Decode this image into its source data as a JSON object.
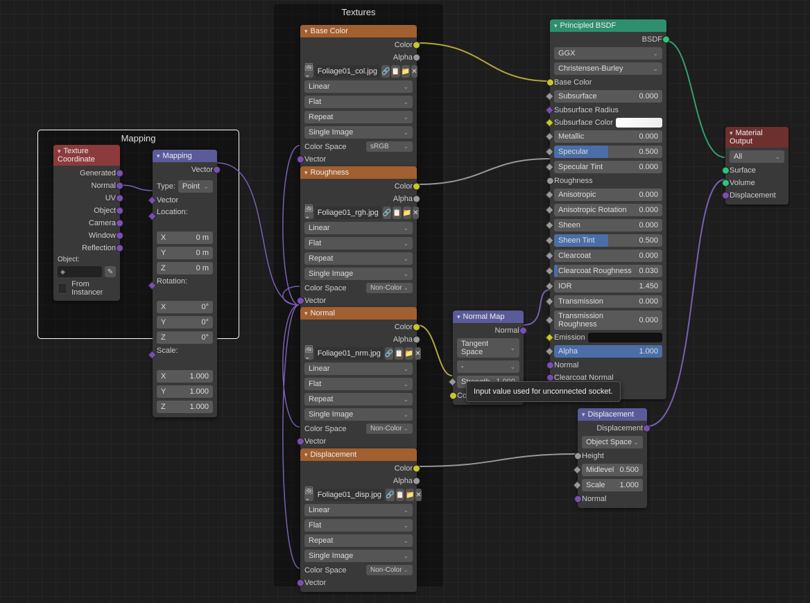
{
  "frames": {
    "mapping": {
      "title": "Mapping"
    },
    "textures": {
      "title": "Textures"
    }
  },
  "texcoord": {
    "title": "Texture Coordinate",
    "outputs": [
      "Generated",
      "Normal",
      "UV",
      "Object",
      "Camera",
      "Window",
      "Reflection"
    ],
    "object_label": "Object:",
    "from_instancer": "From Instancer"
  },
  "mapping": {
    "title": "Mapping",
    "out_vector": "Vector",
    "type_label": "Type:",
    "type_value": "Point",
    "in_vector": "Vector",
    "loc_label": "Location:",
    "rot_label": "Rotation:",
    "scale_label": "Scale:",
    "xyz_loc": [
      [
        "X",
        "0 m"
      ],
      [
        "Y",
        "0 m"
      ],
      [
        "Z",
        "0 m"
      ]
    ],
    "xyz_rot": [
      [
        "X",
        "0°"
      ],
      [
        "Y",
        "0°"
      ],
      [
        "Z",
        "0°"
      ]
    ],
    "xyz_scale": [
      [
        "X",
        "1.000"
      ],
      [
        "Y",
        "1.000"
      ],
      [
        "Z",
        "1.000"
      ]
    ]
  },
  "image_nodes": {
    "base_color": {
      "title": "Base Color",
      "file": "Foliage01_col.jpg",
      "cs": "sRGB"
    },
    "roughness": {
      "title": "Roughness",
      "file": "Foliage01_rgh.jpg",
      "cs": "Non-Color"
    },
    "normal": {
      "title": "Normal",
      "file": "Foliage01_nrm.jpg",
      "cs": "Non-Color"
    },
    "displacement": {
      "title": "Displacement",
      "file": "Foliage01_disp.jpg",
      "cs": "Non-Color"
    },
    "common": {
      "out_color": "Color",
      "out_alpha": "Alpha",
      "interp": "Linear",
      "proj": "Flat",
      "ext": "Repeat",
      "src": "Single Image",
      "cs_label": "Color Space",
      "in_vector": "Vector"
    }
  },
  "normal_map": {
    "title": "Normal Map",
    "out_normal": "Normal",
    "space": "Tangent Space",
    "strength_label": "Strength",
    "strength_value": "1.000",
    "in_color": "Color"
  },
  "bsdf": {
    "title": "Principled BSDF",
    "out": "BSDF",
    "dist": "GGX",
    "sss": "Christensen-Burley",
    "inputs": [
      {
        "name": "Base Color",
        "type": "color"
      },
      {
        "name": "Subsurface",
        "type": "slider",
        "val": "0.000",
        "fill": 0
      },
      {
        "name": "Subsurface Radius",
        "type": "vector"
      },
      {
        "name": "Subsurface Color",
        "type": "swatch"
      },
      {
        "name": "Metallic",
        "type": "slider",
        "val": "0.000",
        "fill": 0
      },
      {
        "name": "Specular",
        "type": "slider",
        "val": "0.500",
        "fill": 50
      },
      {
        "name": "Specular Tint",
        "type": "slider",
        "val": "0.000",
        "fill": 0
      },
      {
        "name": "Roughness",
        "type": "linked"
      },
      {
        "name": "Anisotropic",
        "type": "slider",
        "val": "0.000",
        "fill": 0
      },
      {
        "name": "Anisotropic Rotation",
        "type": "slider",
        "val": "0.000",
        "fill": 0
      },
      {
        "name": "Sheen",
        "type": "slider",
        "val": "0.000",
        "fill": 0
      },
      {
        "name": "Sheen Tint",
        "type": "slider",
        "val": "0.500",
        "fill": 50
      },
      {
        "name": "Clearcoat",
        "type": "slider",
        "val": "0.000",
        "fill": 0
      },
      {
        "name": "Clearcoat Roughness",
        "type": "slider",
        "val": "0.030",
        "fill": 3
      },
      {
        "name": "IOR",
        "type": "num",
        "val": "1.450"
      },
      {
        "name": "Transmission",
        "type": "slider",
        "val": "0.000",
        "fill": 0
      },
      {
        "name": "Transmission Roughness",
        "type": "slider",
        "val": "0.000",
        "fill": 0
      },
      {
        "name": "Emission",
        "type": "swatch-dark"
      },
      {
        "name": "Alpha",
        "type": "slider",
        "val": "1.000",
        "fill": 100
      },
      {
        "name": "Normal",
        "type": "linked-vec"
      },
      {
        "name": "Clearcoat Normal",
        "type": "vec"
      },
      {
        "name": "Tangent",
        "type": "vec"
      }
    ]
  },
  "displacement_node": {
    "title": "Displacement",
    "out": "Displacement",
    "space": "Object Space",
    "height": "Height",
    "midlevel_label": "Midlevel",
    "midlevel_val": "0.500",
    "scale_label": "Scale",
    "scale_val": "1.000",
    "normal": "Normal"
  },
  "material_output": {
    "title": "Material Output",
    "target": "All",
    "surface": "Surface",
    "volume": "Volume",
    "displacement": "Displacement"
  },
  "tooltip": "Input value used for unconnected socket."
}
